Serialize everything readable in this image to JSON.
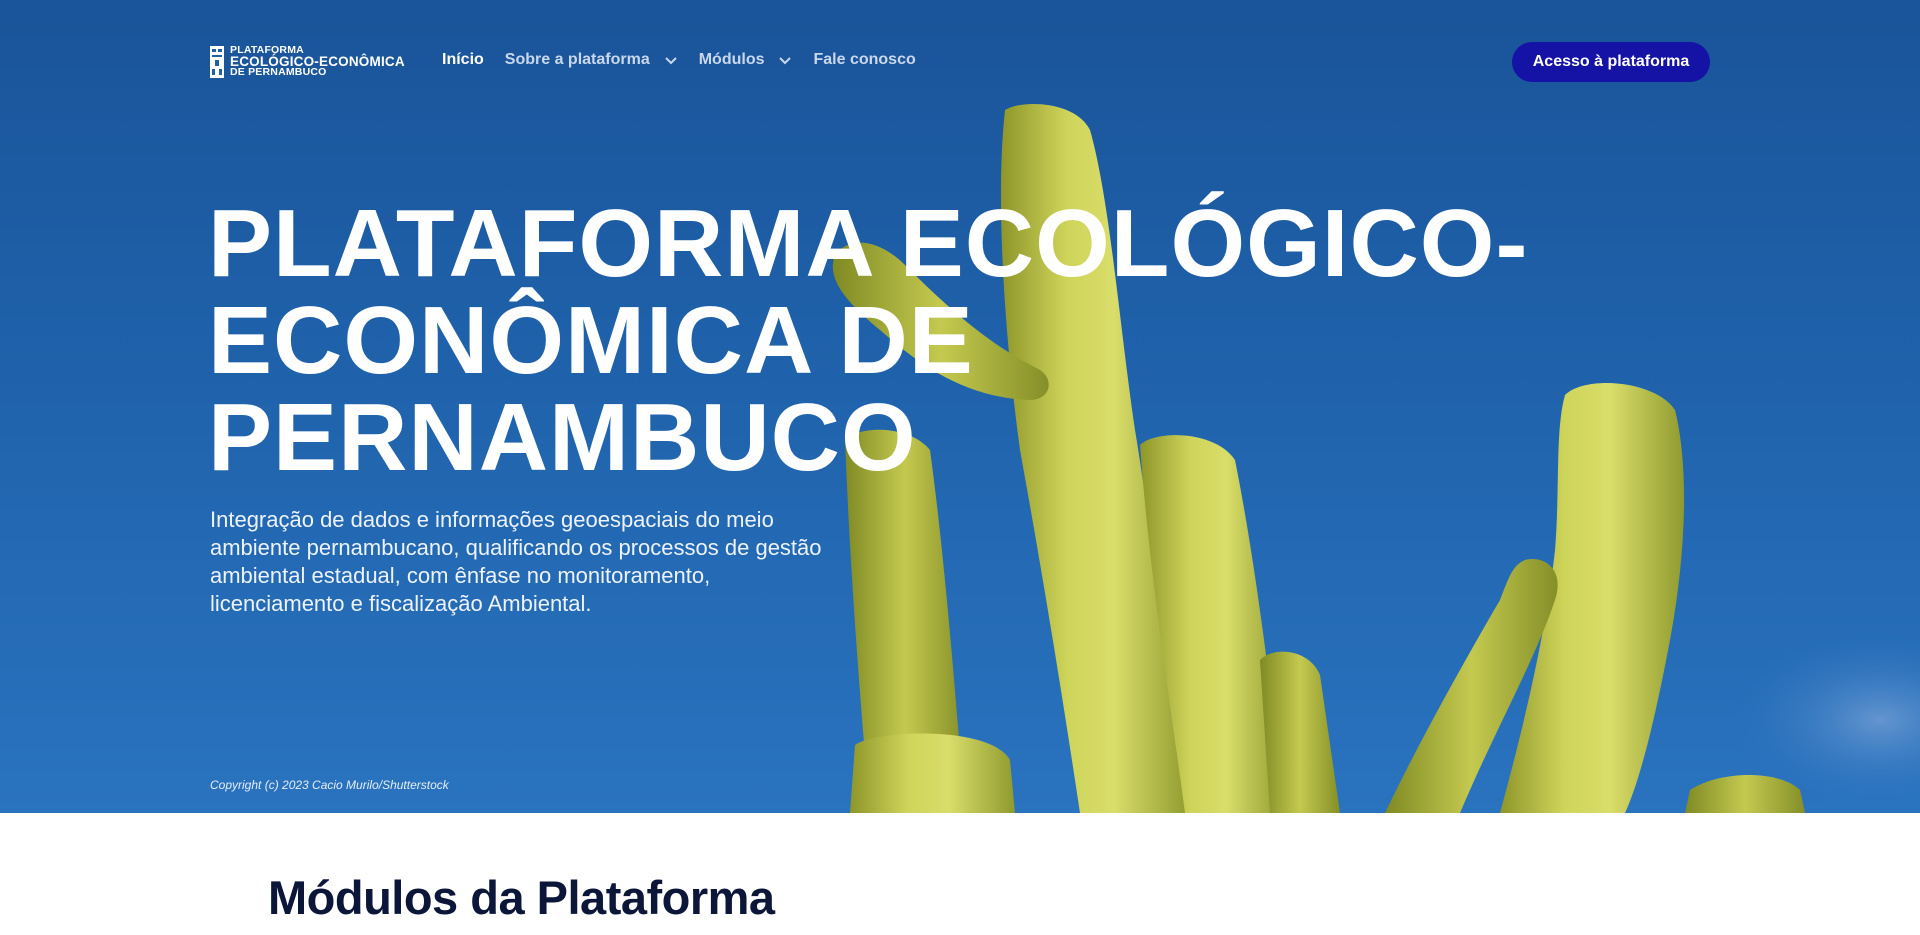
{
  "header": {
    "logo": {
      "line1": "PLATAFORMA",
      "line2": "ECOLÓGICO-ECONÔMICA",
      "line3": "DE PERNAMBUCO",
      "icon": "grid-logo-icon"
    },
    "nav": [
      {
        "label": "Início",
        "active": true
      },
      {
        "label": "Sobre a plataforma",
        "dropdown": true,
        "icon": "chevron-down-icon"
      },
      {
        "label": "Módulos",
        "dropdown": true,
        "icon": "chevron-down-icon"
      },
      {
        "label": "Fale conosco"
      }
    ],
    "cta_label": "Acesso à plataforma"
  },
  "hero": {
    "title": "PLATAFORMA ECOLÓGICO-ECONÔMICA DE PERNAMBUCO",
    "subtitle": "Integração de dados e informações geoespaciais do meio ambiente pernambucano, qualificando os processos de gestão ambiental estadual, com ênfase no monitoramento, licenciamento e fiscalização Ambiental.",
    "copyright": "Copyright (c) 2023 Cacio Murilo/Shutterstock"
  },
  "section": {
    "title": "Módulos da Plataforma"
  },
  "colors": {
    "sky": "#1f62ab",
    "cta": "#1512a6",
    "cactus": "#c7cc4a",
    "section_title": "#0b1638"
  }
}
